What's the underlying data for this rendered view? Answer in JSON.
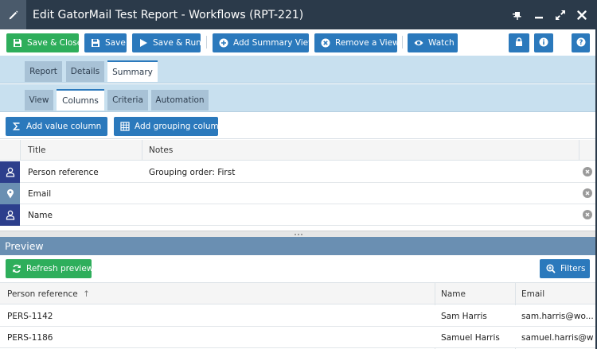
{
  "window": {
    "title": "Edit GatorMail Test Report - Workflows (RPT-221)",
    "controls": [
      "pin-icon",
      "minimize-icon",
      "expand-icon",
      "close-icon"
    ]
  },
  "toolbar": {
    "save_close": "Save & Close",
    "save": "Save",
    "save_run": "Save & Run",
    "add_summary_view": "Add Summary View",
    "remove_view": "Remove a View",
    "watch": "Watch"
  },
  "main_tabs": [
    {
      "label": "Report",
      "active": false
    },
    {
      "label": "Details",
      "active": false
    },
    {
      "label": "Summary",
      "active": true
    }
  ],
  "sub_tabs": [
    {
      "label": "View",
      "active": false
    },
    {
      "label": "Columns",
      "active": true
    },
    {
      "label": "Criteria",
      "active": false
    },
    {
      "label": "Automation",
      "active": false
    }
  ],
  "columns_toolbar": {
    "add_value_column": "Add value column",
    "add_grouping_column": "Add grouping column"
  },
  "columns_table": {
    "headers": [
      "Title",
      "Notes"
    ],
    "rows": [
      {
        "icon": "person-icon",
        "title": "Person reference",
        "notes": "Grouping order: First"
      },
      {
        "icon": "location-pin-icon",
        "title": "Email",
        "notes": ""
      },
      {
        "icon": "person-icon",
        "title": "Name",
        "notes": ""
      }
    ]
  },
  "preview": {
    "heading": "Preview",
    "refresh_label": "Refresh preview",
    "filters_label": "Filters",
    "headers": [
      "Person reference",
      "Name",
      "Email"
    ],
    "sort_indicator": "↑",
    "rows": [
      {
        "ref": "PERS-1142",
        "name": "Sam Harris",
        "email": "sam.harris@wo..."
      },
      {
        "ref": "PERS-1186",
        "name": "Samuel Harris",
        "email": "samuel.harris@w..."
      }
    ]
  },
  "colors": {
    "title_bar": "#2b3a4a",
    "primary_blue": "#2b79bc",
    "green": "#2eae5b",
    "tab_strip": "#c8e0ef",
    "preview_header": "#6a8fb2",
    "person_icon_box": "#2c3e8c",
    "pin_icon_box": "#6a8fb2"
  }
}
